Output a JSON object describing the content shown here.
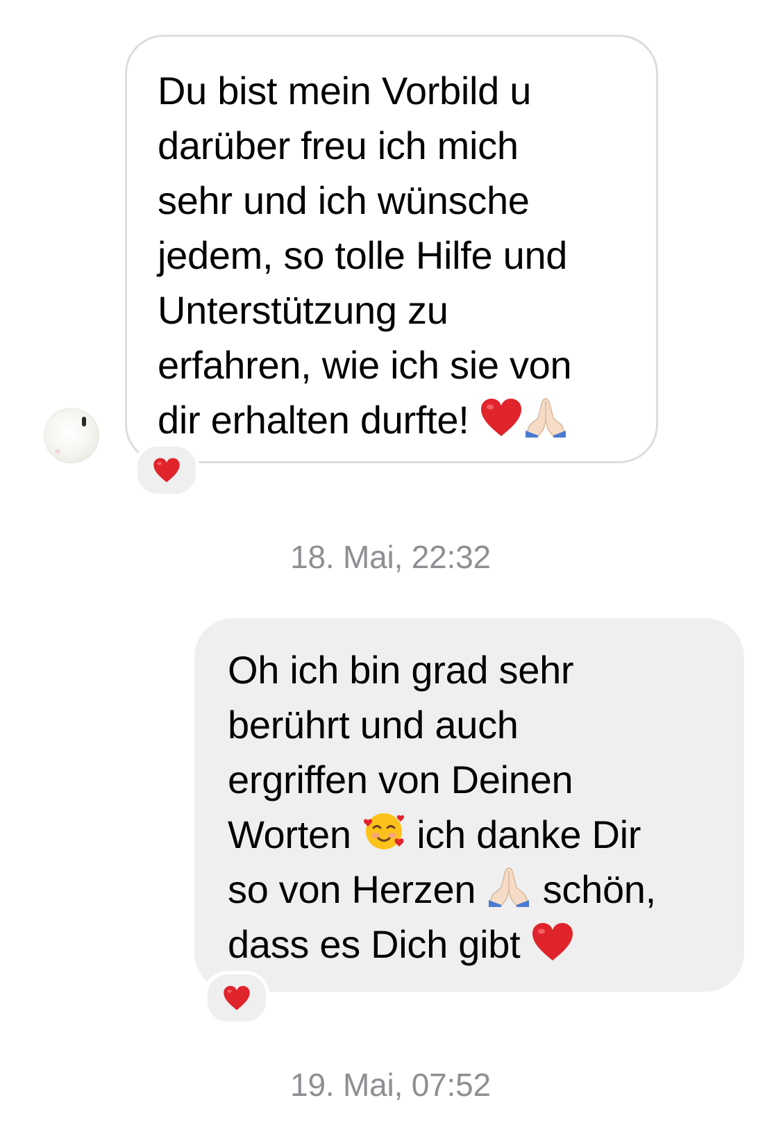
{
  "conversation": {
    "incoming_message": {
      "lines": [
        "Du bist mein Vorbild u",
        "darüber freu ich mich",
        "sehr und ich wünsche",
        "jedem, so tolle Hilfe und",
        "Unterstützung zu",
        "erfahren, wie ich sie von",
        "dir erhalten durfte!"
      ],
      "trailing_emojis": [
        "red-heart",
        "folded-hands"
      ],
      "reaction": "red-heart"
    },
    "timestamp_1": "18. Mai, 22:32",
    "outgoing_message": {
      "line_1": "Oh ich bin grad sehr",
      "line_2": "berührt und auch",
      "line_3": "ergriffen von Deinen",
      "line_4_a": "Worten ",
      "line_4_emoji": "smiling-face-with-hearts",
      "line_4_b": " ich danke Dir",
      "line_5_a": "so von Herzen ",
      "line_5_emoji": "folded-hands",
      "line_5_b": " schön,",
      "line_6_a": "dass es Dich gibt ",
      "line_6_emoji": "red-heart",
      "reaction": "red-heart"
    },
    "timestamp_2": "19. Mai, 07:52"
  },
  "colors": {
    "incoming_bubble_border": "#dcdcdc",
    "outgoing_bubble_bg": "#efefef",
    "timestamp_text": "#8e8e93",
    "heart_red": "#e0242b"
  }
}
